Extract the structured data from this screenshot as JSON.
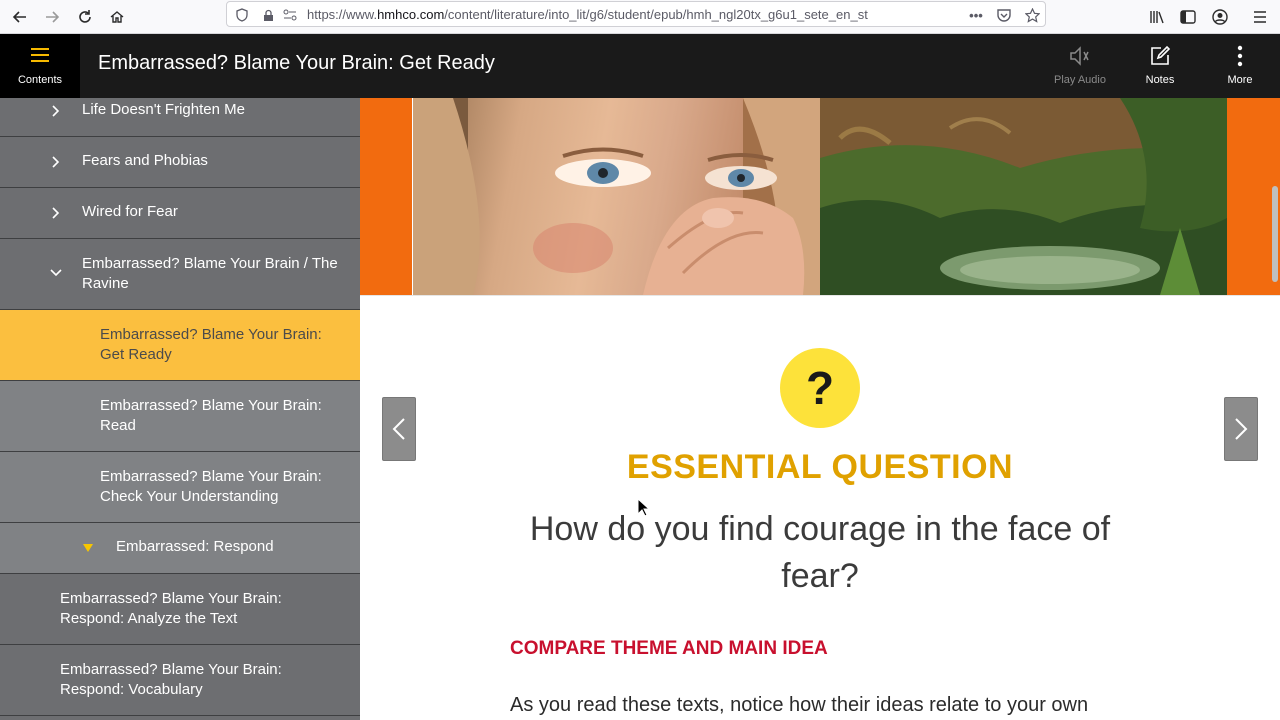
{
  "browser": {
    "url_prefix": "https://www.",
    "url_host": "hmhco.com",
    "url_path": "/content/literature/into_lit/g6/student/epub/hmh_ngl20tx_g6u1_sete_en_st"
  },
  "header": {
    "contents_label": "Contents",
    "page_title": "Embarrassed? Blame Your Brain: Get Ready",
    "play_audio_label": "Play Audio",
    "notes_label": "Notes",
    "more_label": "More"
  },
  "sidebar": {
    "items": [
      {
        "label": "Life Doesn't Frighten Me"
      },
      {
        "label": "Fears and Phobias"
      },
      {
        "label": "Wired for Fear"
      },
      {
        "label": "Embarrassed? Blame Your Brain / The Ravine"
      },
      {
        "label": "Embarrassed? Blame Your Brain: Get Ready"
      },
      {
        "label": "Embarrassed? Blame Your Brain: Read"
      },
      {
        "label": "Embarrassed? Blame Your Brain: Check Your Understanding"
      },
      {
        "label": "Embarrassed: Respond"
      },
      {
        "label": "Embarrassed? Blame Your Brain: Respond: Analyze the Text"
      },
      {
        "label": "Embarrassed? Blame Your Brain: Respond: Vocabulary"
      }
    ]
  },
  "content": {
    "eq_symbol": "?",
    "eq_heading": "ESSENTIAL QUESTION",
    "eq_question": "How do you find courage in the face of fear?",
    "compare_heading": "COMPARE THEME AND MAIN IDEA",
    "body_text": "As you read these texts, notice how their ideas relate to your own"
  },
  "colors": {
    "accent_yellow": "#fbbf3f",
    "heading_gold": "#e0a100",
    "compare_red": "#c8102e",
    "orange_band": "#f26b0f"
  },
  "icons": {
    "back": "back-arrow-icon",
    "forward": "forward-arrow-icon",
    "reload": "reload-icon",
    "home": "home-icon",
    "contents": "hamburger-menu-icon",
    "play_audio": "speaker-icon",
    "notes": "pencil-note-icon",
    "more": "kebab-menu-icon"
  }
}
